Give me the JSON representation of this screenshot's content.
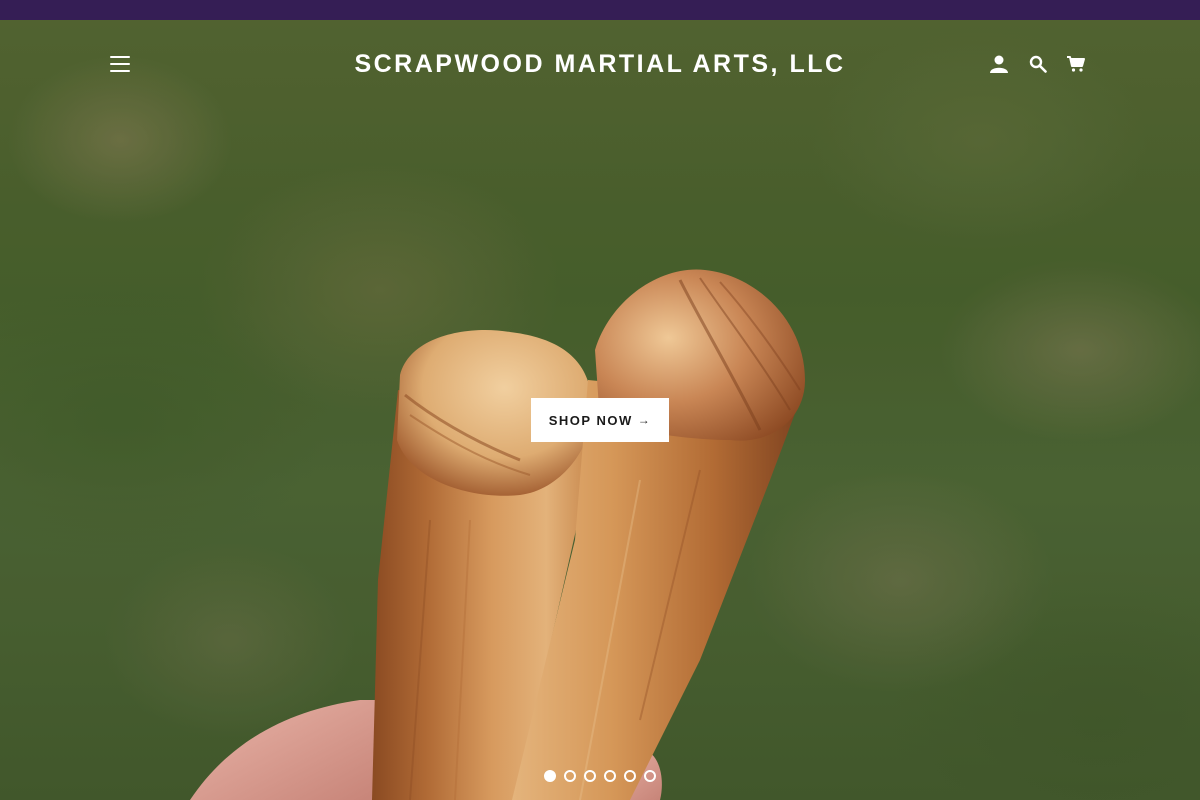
{
  "header": {
    "site_title": "SCRAPWOOD MARTIAL ARTS, LLC",
    "icons": [
      "menu-icon",
      "account-icon",
      "search-icon",
      "cart-icon"
    ]
  },
  "hero": {
    "cta_label": "SHOP NOW",
    "cta_arrow": "→"
  },
  "slideshow": {
    "slide_count": 6,
    "active_slide": 1
  },
  "colors": {
    "announcement_bar": "#351e55",
    "header_text": "#ffffff",
    "cta_background": "#ffffff",
    "cta_text": "#1a1a1a"
  }
}
